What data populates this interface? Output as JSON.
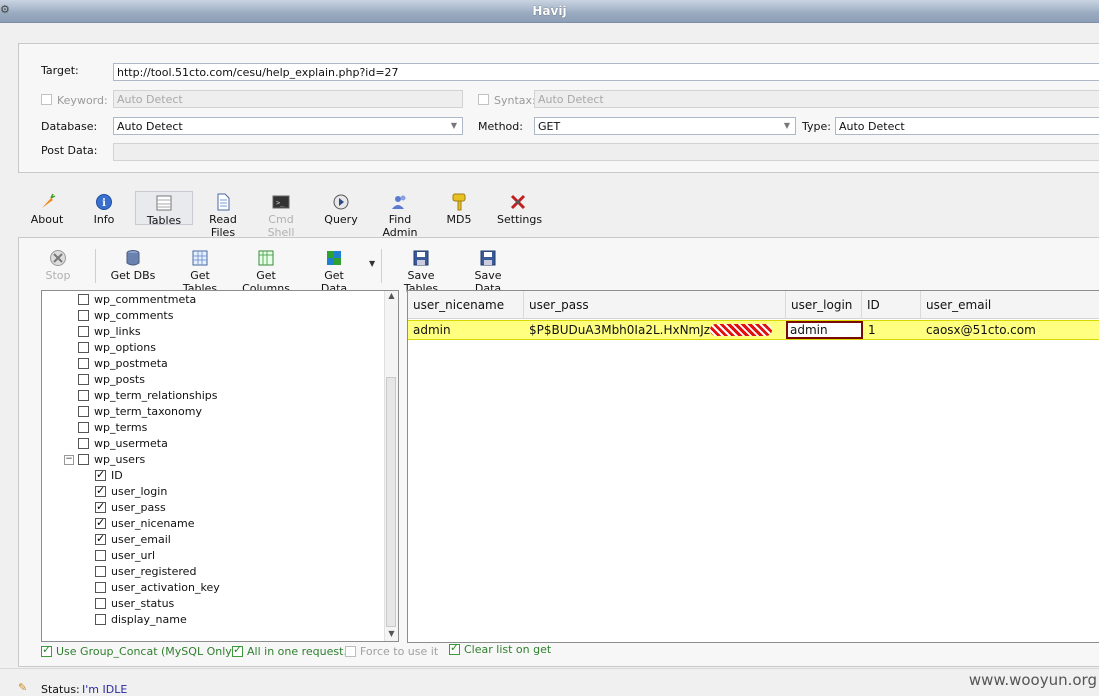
{
  "window": {
    "title": "Havij"
  },
  "target_panel": {
    "target_label": "Target:",
    "target_value": "http://tool.51cto.com/cesu/help_explain.php?id=27",
    "keyword_label": "Keyword:",
    "keyword_placeholder": "Auto Detect",
    "syntax_label": "Syntax:",
    "syntax_placeholder": "Auto Detect",
    "database_label": "Database:",
    "database_value": "Auto Detect",
    "method_label": "Method:",
    "method_value": "GET",
    "type_label": "Type:",
    "type_value": "Auto Detect",
    "postdata_label": "Post Data:",
    "postdata_value": ""
  },
  "main_toolbar": [
    {
      "label": "About",
      "icon": "carrot-icon"
    },
    {
      "label": "Info",
      "icon": "info-icon"
    },
    {
      "label": "Tables",
      "icon": "table-icon"
    },
    {
      "label": "Read Files",
      "icon": "file-icon"
    },
    {
      "label": "Cmd Shell",
      "icon": "terminal-icon"
    },
    {
      "label": "Query",
      "icon": "query-icon"
    },
    {
      "label": "Find Admin",
      "icon": "users-icon"
    },
    {
      "label": "MD5",
      "icon": "key-icon"
    },
    {
      "label": "Settings",
      "icon": "settings-icon"
    }
  ],
  "tables_toolbar": [
    {
      "label": "Stop",
      "icon": "stop-icon"
    },
    {
      "label": "Get DBs",
      "icon": "database-icon"
    },
    {
      "label": "Get Tables",
      "icon": "tables-icon"
    },
    {
      "label": "Get Columns",
      "icon": "columns-icon"
    },
    {
      "label": "Get Data",
      "icon": "data-icon"
    },
    {
      "label": "Save Tables",
      "icon": "save-icon"
    },
    {
      "label": "Save Data",
      "icon": "save-icon"
    }
  ],
  "tree": {
    "tables": [
      "wp_commentmeta",
      "wp_comments",
      "wp_links",
      "wp_options",
      "wp_postmeta",
      "wp_posts",
      "wp_term_relationships",
      "wp_term_taxonomy",
      "wp_terms",
      "wp_usermeta",
      "wp_users"
    ],
    "columns": [
      {
        "name": "ID",
        "checked": true
      },
      {
        "name": "user_login",
        "checked": true
      },
      {
        "name": "user_pass",
        "checked": true
      },
      {
        "name": "user_nicename",
        "checked": true
      },
      {
        "name": "user_email",
        "checked": true
      },
      {
        "name": "user_url",
        "checked": false
      },
      {
        "name": "user_registered",
        "checked": false
      },
      {
        "name": "user_activation_key",
        "checked": false
      },
      {
        "name": "user_status",
        "checked": false
      },
      {
        "name": "display_name",
        "checked": false
      }
    ]
  },
  "grid": {
    "headers": [
      "user_nicename",
      "user_pass",
      "user_login",
      "ID",
      "user_email"
    ],
    "row": {
      "user_nicename": "admin",
      "user_pass": "$P$BUDuA3Mbh0Ia2L.HxNmJz",
      "user_login": "admin",
      "ID": "1",
      "user_email": "caosx@51cto.com"
    }
  },
  "options": {
    "group_concat": "Use Group_Concat (MySQL Only)",
    "all_in_one": "All in one request.",
    "force": "Force to use it",
    "clear_list": "Clear list on get"
  },
  "status": {
    "label": "Status:",
    "value": "I'm IDLE"
  },
  "watermark": "www.wooyun.org"
}
